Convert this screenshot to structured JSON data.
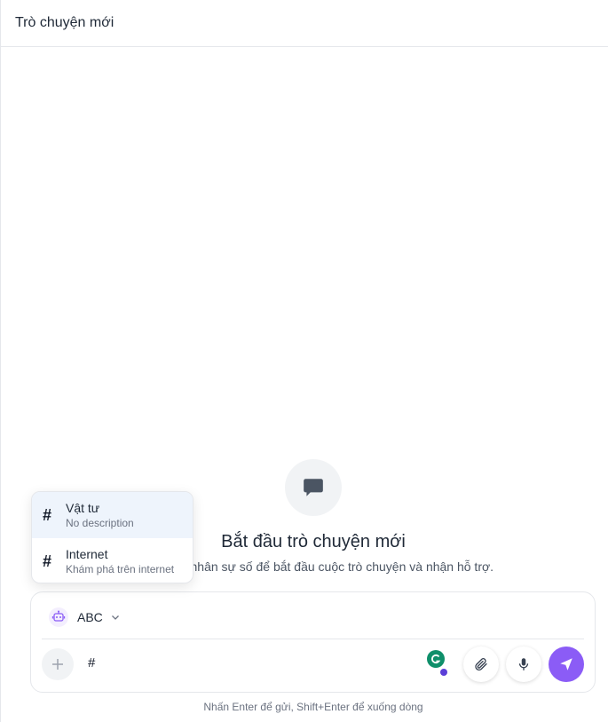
{
  "header": {
    "title": "Trò chuyện mới"
  },
  "empty_state": {
    "icon": "chat-bubble-icon",
    "title": "Bắt đầu trò chuyện mới",
    "subtitle": "Chọn một nhân sự số để bắt đầu cuộc trò chuyện và nhận hỗ trợ."
  },
  "mention_popup": {
    "items": [
      {
        "name": "Vật tư",
        "description": "No description",
        "active": true
      },
      {
        "name": "Internet",
        "description": "Khám phá trên internet",
        "active": false
      }
    ]
  },
  "composer": {
    "agent_name": "ABC",
    "agent_icon": "robot-icon",
    "input_value": "#",
    "buttons": {
      "plus": "plus-icon",
      "attach": "paperclip-icon",
      "mic": "microphone-icon",
      "send": "send-icon"
    }
  },
  "hint": "Nhấn Enter để gửi, Shift+Enter để xuống dòng",
  "colors": {
    "accent": "#8b5cf6",
    "popup_active_bg": "#eef4fc",
    "border": "#e5e7eb",
    "muted_text": "#6b7280"
  }
}
